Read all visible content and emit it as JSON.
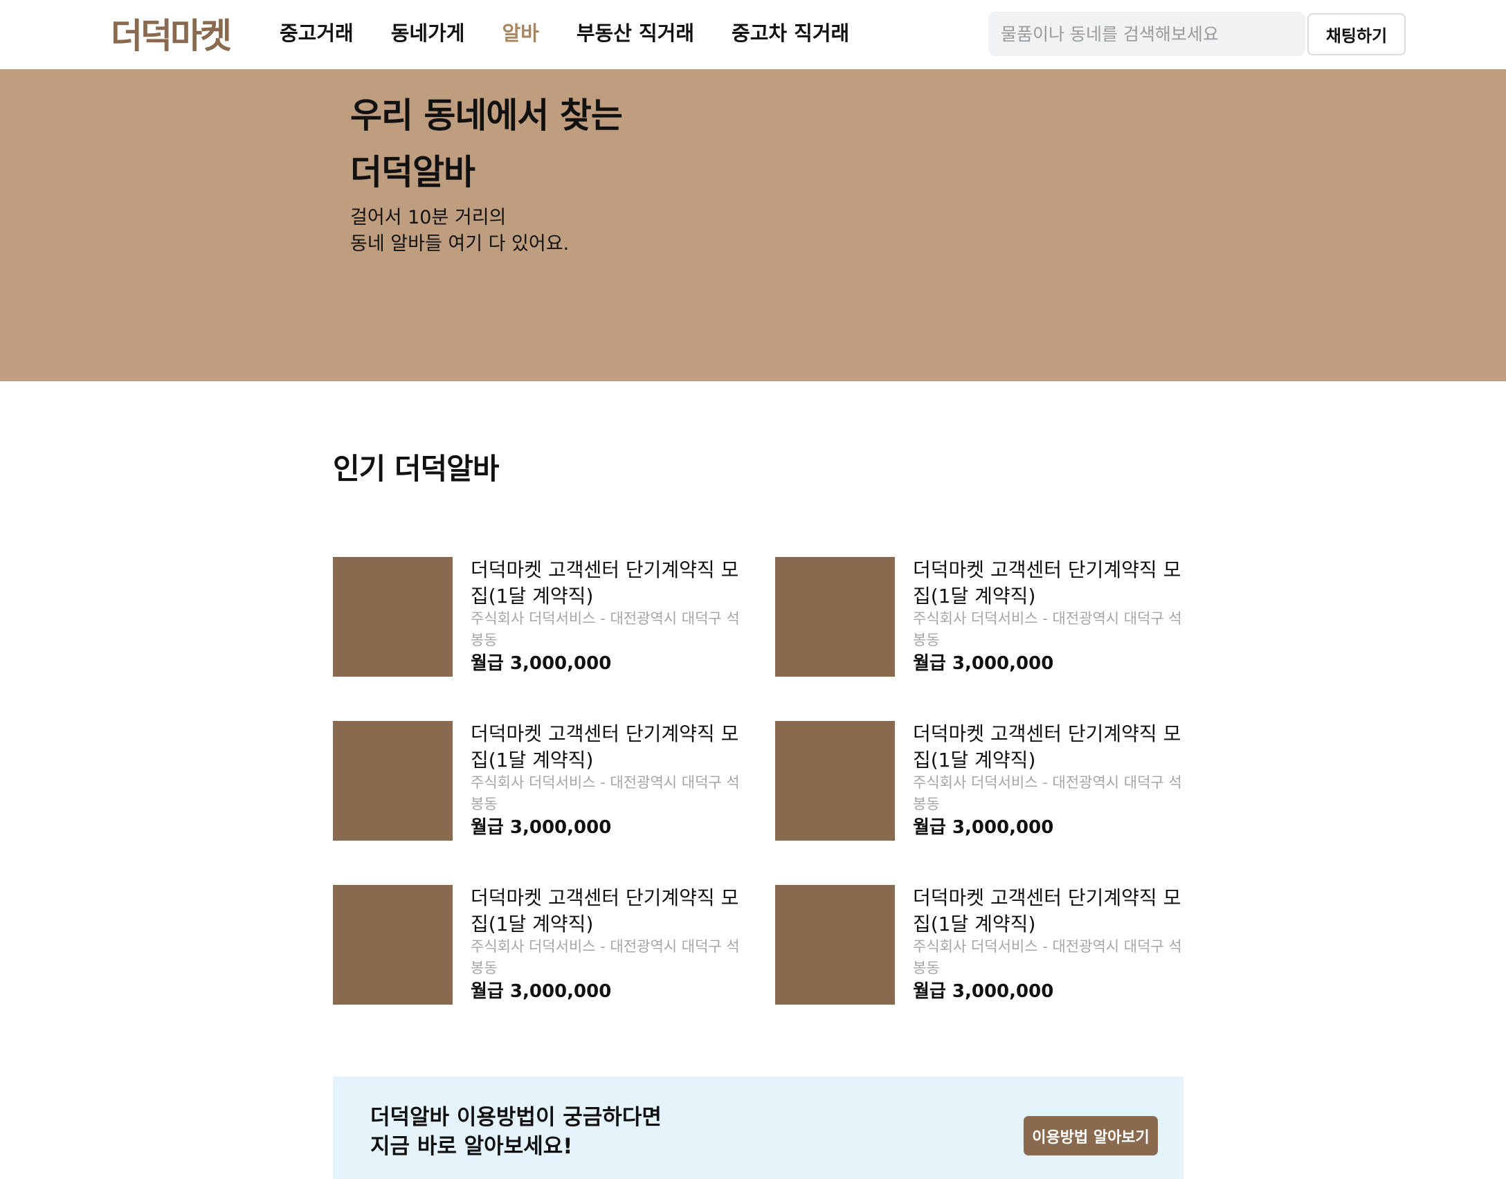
{
  "header": {
    "logo": "더덕마켓",
    "nav": [
      {
        "label": "중고거래",
        "active": false
      },
      {
        "label": "동네가게",
        "active": false
      },
      {
        "label": "알바",
        "active": true
      },
      {
        "label": "부동산 직거래",
        "active": false
      },
      {
        "label": "중고차 직거래",
        "active": false
      }
    ],
    "search_placeholder": "물품이나 동네를 검색해보세요",
    "chat_button": "채팅하기"
  },
  "hero": {
    "title_line1": "우리 동네에서 찾는",
    "title_line2": "더덕알바",
    "desc_line1": "걸어서 10분 거리의",
    "desc_line2": "동네 알바들 여기 다 있어요."
  },
  "popular": {
    "title": "인기 더덕알바",
    "jobs": [
      {
        "title": "더덕마켓 고객센터 단기계약직 모집(1달 계약직)",
        "meta": "주식회사 더덕서비스 - 대전광역시 대덕구 석봉동",
        "pay": "월급 3,000,000"
      },
      {
        "title": "더덕마켓 고객센터 단기계약직 모집(1달 계약직)",
        "meta": "주식회사 더덕서비스 - 대전광역시 대덕구 석봉동",
        "pay": "월급 3,000,000"
      },
      {
        "title": "더덕마켓 고객센터 단기계약직 모집(1달 계약직)",
        "meta": "주식회사 더덕서비스 - 대전광역시 대덕구 석봉동",
        "pay": "월급 3,000,000"
      },
      {
        "title": "더덕마켓 고객센터 단기계약직 모집(1달 계약직)",
        "meta": "주식회사 더덕서비스 - 대전광역시 대덕구 석봉동",
        "pay": "월급 3,000,000"
      },
      {
        "title": "더덕마켓 고객센터 단기계약직 모집(1달 계약직)",
        "meta": "주식회사 더덕서비스 - 대전광역시 대덕구 석봉동",
        "pay": "월급 3,000,000"
      },
      {
        "title": "더덕마켓 고객센터 단기계약직 모집(1달 계약직)",
        "meta": "주식회사 더덕서비스 - 대전광역시 대덕구 석봉동",
        "pay": "월급 3,000,000"
      }
    ]
  },
  "banner": {
    "line1": "더덕알바 이용방법이 궁금하다면",
    "line2": "지금 바로 알아보세요!",
    "button": "이용방법 알아보기"
  },
  "colors": {
    "brand": "#8a6a4f",
    "hero_bg": "#bf9d7f",
    "nav_active": "#a8845f",
    "banner_bg": "#e5f3fb"
  }
}
